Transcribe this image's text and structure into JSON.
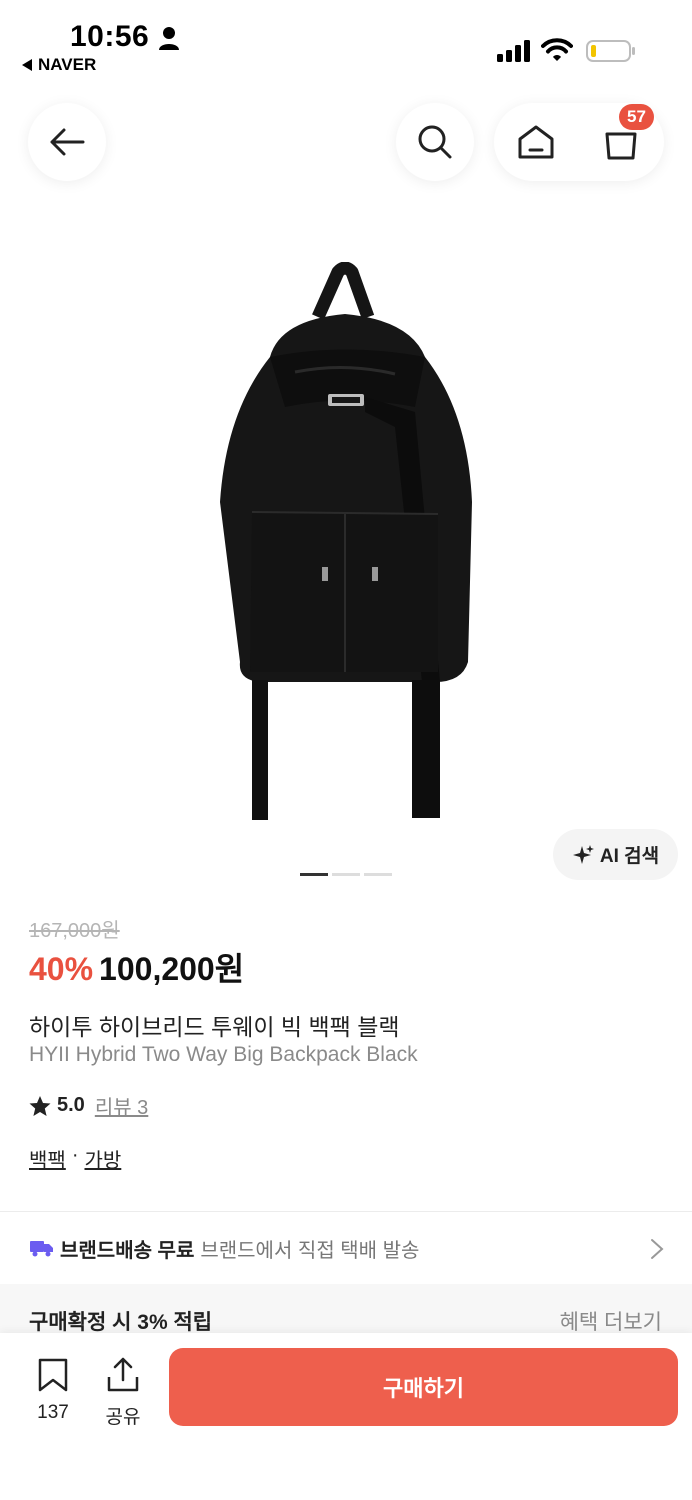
{
  "status_bar": {
    "time": "10:56",
    "back_app": "NAVER"
  },
  "nav": {
    "cart_count": "57"
  },
  "ai_search": {
    "label": "AI 검색"
  },
  "carousel": {
    "total": 3,
    "active": 1
  },
  "product": {
    "original_price": "167,000원",
    "discount": "40%",
    "price": "100,200원",
    "title_ko": "하이투 하이브리드 투웨이 빅 백팩 블랙",
    "title_en": "HYII Hybrid Two Way Big Backpack Black",
    "rating": "5.0",
    "review_label": "리뷰 3",
    "category_1": "백팩",
    "category_sep": "·",
    "category_2": "가방"
  },
  "shipping": {
    "label": "브랜드배송 무료",
    "desc": "브랜드에서 직접 택배 발송"
  },
  "benefit": {
    "label": "구매확정 시 3% 적립",
    "more": "혜택 더보기"
  },
  "bottom": {
    "bookmark_count": "137",
    "share_label": "공유",
    "buy_label": "구매하기"
  },
  "colors": {
    "accent": "#e9513f",
    "buy_button": "#ee5f4d",
    "shipping_truck": "#6b5cf0"
  }
}
